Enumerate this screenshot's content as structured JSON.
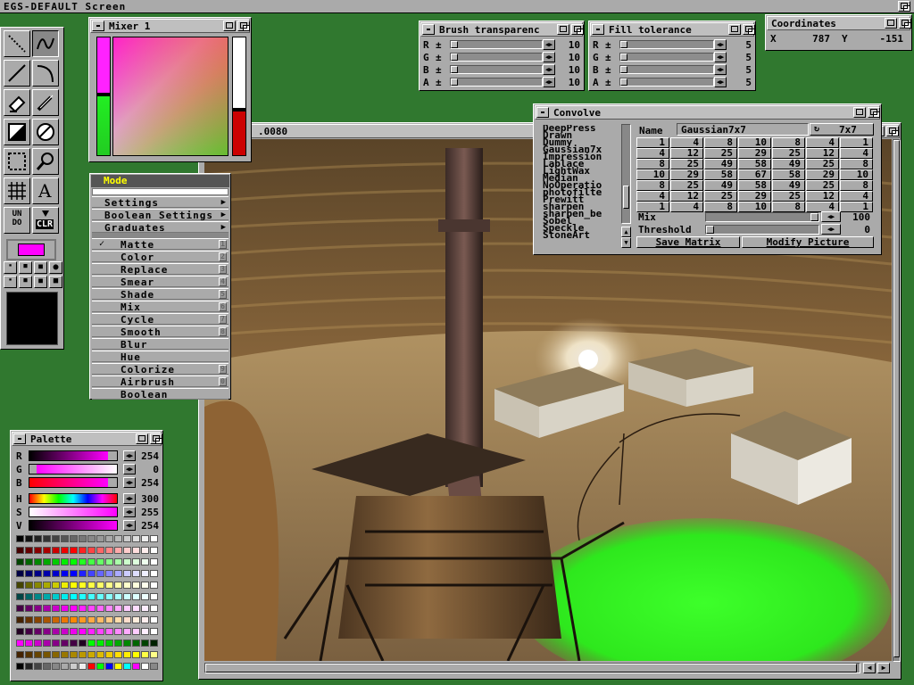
{
  "screen": {
    "title": "EGS-DEFAULT Screen"
  },
  "canvas": {
    "title_fragment": ".0080"
  },
  "mixer": {
    "title": "Mixer 1"
  },
  "brush": {
    "title": "Brush transparenc",
    "rows": [
      {
        "label": "R",
        "pm": "±",
        "value": "10"
      },
      {
        "label": "G",
        "pm": "±",
        "value": "10"
      },
      {
        "label": "B",
        "pm": "±",
        "value": "10"
      },
      {
        "label": "A",
        "pm": "±",
        "value": "10"
      }
    ]
  },
  "fill": {
    "title": "Fill tolerance",
    "rows": [
      {
        "label": "R",
        "pm": "±",
        "value": "5"
      },
      {
        "label": "G",
        "pm": "±",
        "value": "5"
      },
      {
        "label": "B",
        "pm": "±",
        "value": "5"
      },
      {
        "label": "A",
        "pm": "±",
        "value": "5"
      }
    ]
  },
  "coords": {
    "title": "Coordinates",
    "x_label": "X",
    "x": "787",
    "y_label": "Y",
    "y": "-151"
  },
  "convolve": {
    "title": "Convolve",
    "list": [
      "DeepPress",
      "Drawn",
      "Dummy",
      "Gaussian7x",
      "Impression",
      "Laplace",
      "LightWax",
      "Median",
      "NoOperatio",
      "photofilte",
      "Prewitt",
      "sharpen",
      "sharpen_be",
      "Sobel",
      "Speckle",
      "StoneArt"
    ],
    "name_label": "Name",
    "name_value": "Gaussian7x7",
    "size_label": "7x7",
    "matrix": [
      [
        "1",
        "4",
        "8",
        "10",
        "8",
        "4",
        "1"
      ],
      [
        "4",
        "12",
        "25",
        "29",
        "25",
        "12",
        "4"
      ],
      [
        "8",
        "25",
        "49",
        "58",
        "49",
        "25",
        "8"
      ],
      [
        "10",
        "29",
        "58",
        "67",
        "58",
        "29",
        "10"
      ],
      [
        "8",
        "25",
        "49",
        "58",
        "49",
        "25",
        "8"
      ],
      [
        "4",
        "12",
        "25",
        "29",
        "25",
        "12",
        "4"
      ],
      [
        "1",
        "4",
        "8",
        "10",
        "8",
        "4",
        "1"
      ]
    ],
    "mix_label": "Mix",
    "mix_value": "100",
    "threshold_label": "Threshold",
    "threshold_value": "0",
    "save_label": "Save Matrix",
    "modify_label": "Modify Picture"
  },
  "mode_menu": {
    "header": "Mode",
    "submenus": [
      "Settings",
      "Boolean Settings",
      "Graduates"
    ],
    "items": [
      {
        "label": "Matte",
        "key": "1",
        "checked": true
      },
      {
        "label": "Color",
        "key": "2"
      },
      {
        "label": "Replace",
        "key": "3"
      },
      {
        "label": "Smear",
        "key": "4"
      },
      {
        "label": "Shade",
        "key": "5"
      },
      {
        "label": "Mix",
        "key": "6"
      },
      {
        "label": "Cycle",
        "key": "7"
      },
      {
        "label": "Smooth",
        "key": "8"
      },
      {
        "label": "Blur",
        "key": ""
      },
      {
        "label": "Hue",
        "key": ""
      },
      {
        "label": "Colorize",
        "key": "9"
      },
      {
        "label": "Airbrush",
        "key": "0"
      },
      {
        "label": "Boolean",
        "key": ""
      }
    ]
  },
  "tools": {
    "undo_label": "UN\nDO",
    "clr_label": "CLR",
    "text_glyph": "A",
    "current_color": "#ff00ff"
  },
  "palette": {
    "title": "Palette",
    "rgb": [
      {
        "label": "R",
        "value": "254"
      },
      {
        "label": "G",
        "value": "0"
      },
      {
        "label": "B",
        "value": "254"
      }
    ],
    "hsv": [
      {
        "label": "H",
        "value": "300"
      },
      {
        "label": "S",
        "value": "255"
      },
      {
        "label": "V",
        "value": "254"
      }
    ]
  },
  "colors": {
    "desktop": "#30782f",
    "window": "#aaaaaa",
    "accent": "#ff00ff",
    "highlight": "#ffff00"
  }
}
